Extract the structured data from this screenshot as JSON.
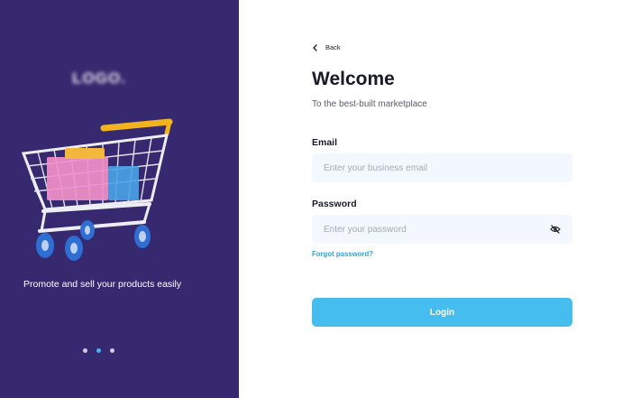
{
  "left_panel": {
    "logo_text": "LOGO.",
    "tagline": "Promote and sell your products easily",
    "carousel_dots": 3,
    "active_dot": 1,
    "accent_color": "#36296f"
  },
  "form": {
    "back_label": "Back",
    "title": "Welcome",
    "subtitle": "To the best-built marketplace",
    "email_label": "Email",
    "email_placeholder": "Enter your business email",
    "email_value": "",
    "password_label": "Password",
    "password_placeholder": "Enter your password",
    "password_value": "",
    "password_toggle_icon": "eye-off-icon",
    "forgot_label": "Forgot password?",
    "login_label": "Login",
    "button_color": "#45bdee"
  }
}
